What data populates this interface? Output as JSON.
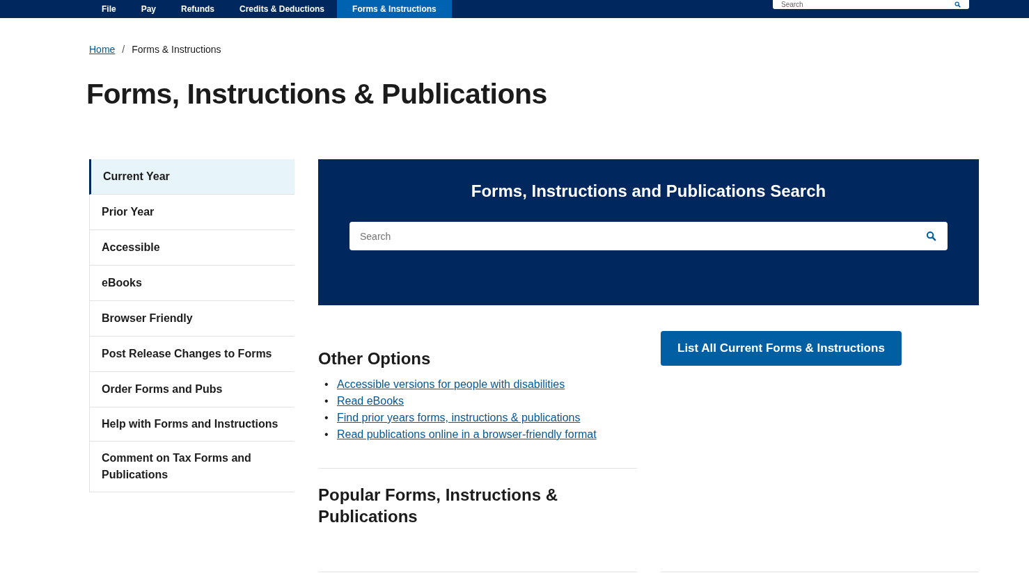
{
  "nav": {
    "items": [
      {
        "label": "File",
        "selected": false
      },
      {
        "label": "Pay",
        "selected": false
      },
      {
        "label": "Refunds",
        "selected": false
      },
      {
        "label": "Credits & Deductions",
        "selected": false
      },
      {
        "label": "Forms & Instructions",
        "selected": true
      }
    ],
    "search": {
      "placeholder": "Search"
    }
  },
  "breadcrumb": [
    {
      "label": "Home",
      "kind": "link"
    },
    {
      "label": "/",
      "kind": "separator"
    },
    {
      "label": "Forms & Instructions",
      "kind": "current"
    }
  ],
  "title": "Forms, Instructions & Publications",
  "sidebar": {
    "items": [
      {
        "label": "Current Year",
        "selected": true
      },
      {
        "label": "Prior Year",
        "selected": false
      },
      {
        "label": "Accessible",
        "selected": false
      },
      {
        "label": "eBooks",
        "selected": false
      },
      {
        "label": "Browser Friendly",
        "selected": false
      },
      {
        "label": "Post Release Changes to Forms",
        "selected": false
      },
      {
        "label": "Order Forms and Pubs",
        "selected": false
      },
      {
        "label": "Help with Forms and Instructions",
        "selected": false
      },
      {
        "label": "Comment on Tax Forms and Publications",
        "selected": false
      }
    ]
  },
  "search_panel": {
    "title": "Forms, Instructions and Publications Search",
    "placeholder": "Search"
  },
  "other_options": {
    "title": "Other Options",
    "bullet": "•",
    "links": [
      "Accessible versions for people with disabilities",
      "Read eBooks",
      "Find prior years forms, instructions & publications",
      "Read publications online in a browser-friendly format"
    ]
  },
  "list_button": "List All Current Forms & Instructions",
  "popular": {
    "title": "Popular Forms, Instructions & Publications"
  }
}
